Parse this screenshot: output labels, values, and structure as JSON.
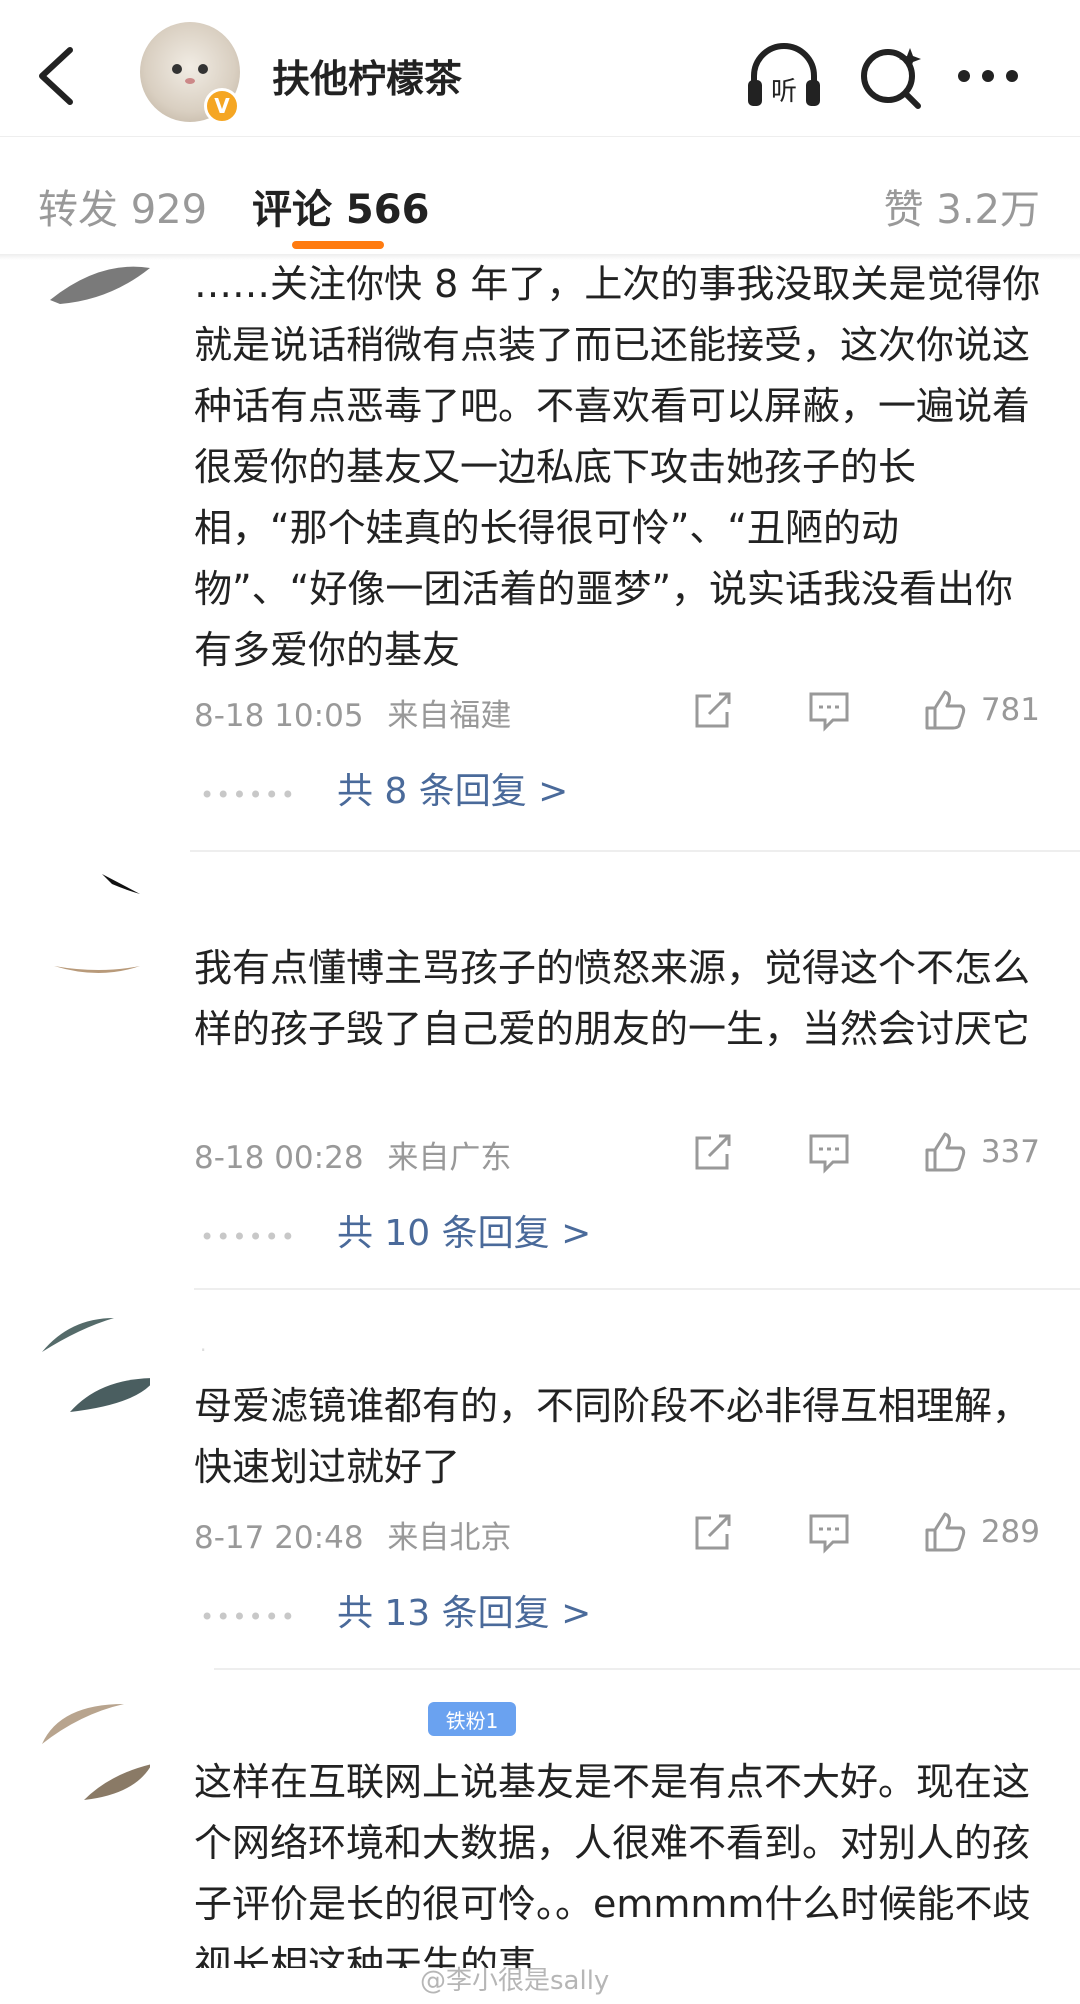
{
  "header": {
    "username": "扶他柠檬茶",
    "verified_badge": "V",
    "icons": [
      "back-icon",
      "listen-icon",
      "search-icon",
      "more-icon"
    ],
    "listen_label": "听"
  },
  "tabs": {
    "repost": "转发 929",
    "comment": "评论 566",
    "like": "赞 3.2万",
    "active_color": "#ff7b10"
  },
  "comments": [
    {
      "text": "……关注你快 8 年了，上次的事我没取关是觉得你就是说话稍微有点装了而已还能接受，这次你说这种话有点恶毒了吧。不喜欢看可以屏蔽，一遍说着很爱你的基友又一边私底下攻击她孩子的长相，“那个娃真的长得很可怜”、“丑陋的动物”、“好像一团活着的噩梦”，说实话我没看出你有多爱你的基友",
      "time": "8-18 10:05",
      "location": "来自福建",
      "likes": "781",
      "replies": "共 8 条回复 >"
    },
    {
      "text": "我有点懂博主骂孩子的愤怒来源，觉得这个不怎么样的孩子毁了自己爱的朋友的一生，当然会讨厌它",
      "time": "8-18 00:28",
      "location": "来自广东",
      "likes": "337",
      "replies": "共 10 条回复 >"
    },
    {
      "text": "母爱滤镜谁都有的，不同阶段不必非得互相理解，快速划过就好了",
      "time": "8-17 20:48",
      "location": "来自北京",
      "likes": "289",
      "replies": "共 13 条回复 >"
    },
    {
      "badge": "铁粉1",
      "text": "这样在互联网上说基友是不是有点不大好。现在这个网络环境和大数据，人很难不看到。对别人的孩子评价是长的很可怜。。emmmm什么时候能不歧视长相这种天生的事"
    }
  ],
  "watermark": "@李小很是sally",
  "colors": {
    "link": "#4a6a9a",
    "meta": "#999999",
    "badge_blue": "#6aa2f0",
    "vip": "#f5a623"
  }
}
